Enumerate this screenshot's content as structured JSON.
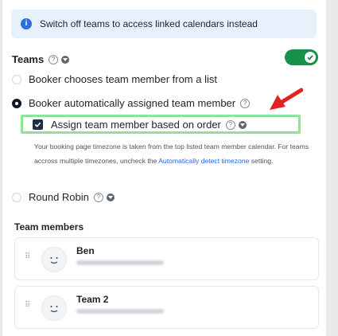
{
  "banner": {
    "icon": "info-icon",
    "text": "Switch off teams to access linked calendars instead"
  },
  "teams": {
    "title": "Teams",
    "toggle_on": true,
    "options": [
      {
        "label": "Booker chooses team member from a list",
        "selected": false
      },
      {
        "label": "Booker automatically assigned team member",
        "selected": true
      },
      {
        "label": "Round Robin",
        "selected": false
      }
    ],
    "assign_checkbox": {
      "label": "Assign team member based on order",
      "checked": true
    },
    "description": {
      "text": "Your booking page timezone is taken from the top listed team member calendar. For teams accross multiple timezones, uncheck the ",
      "link": "Automatically detect timezone",
      "suffix": " setting."
    }
  },
  "members": {
    "title": "Team members",
    "list": [
      {
        "name": "Ben"
      },
      {
        "name": "Team 2"
      }
    ]
  },
  "colors": {
    "toggle": "#17914a",
    "highlight": "#8ee39a",
    "arrow": "#e02424",
    "link": "#2563eb"
  }
}
